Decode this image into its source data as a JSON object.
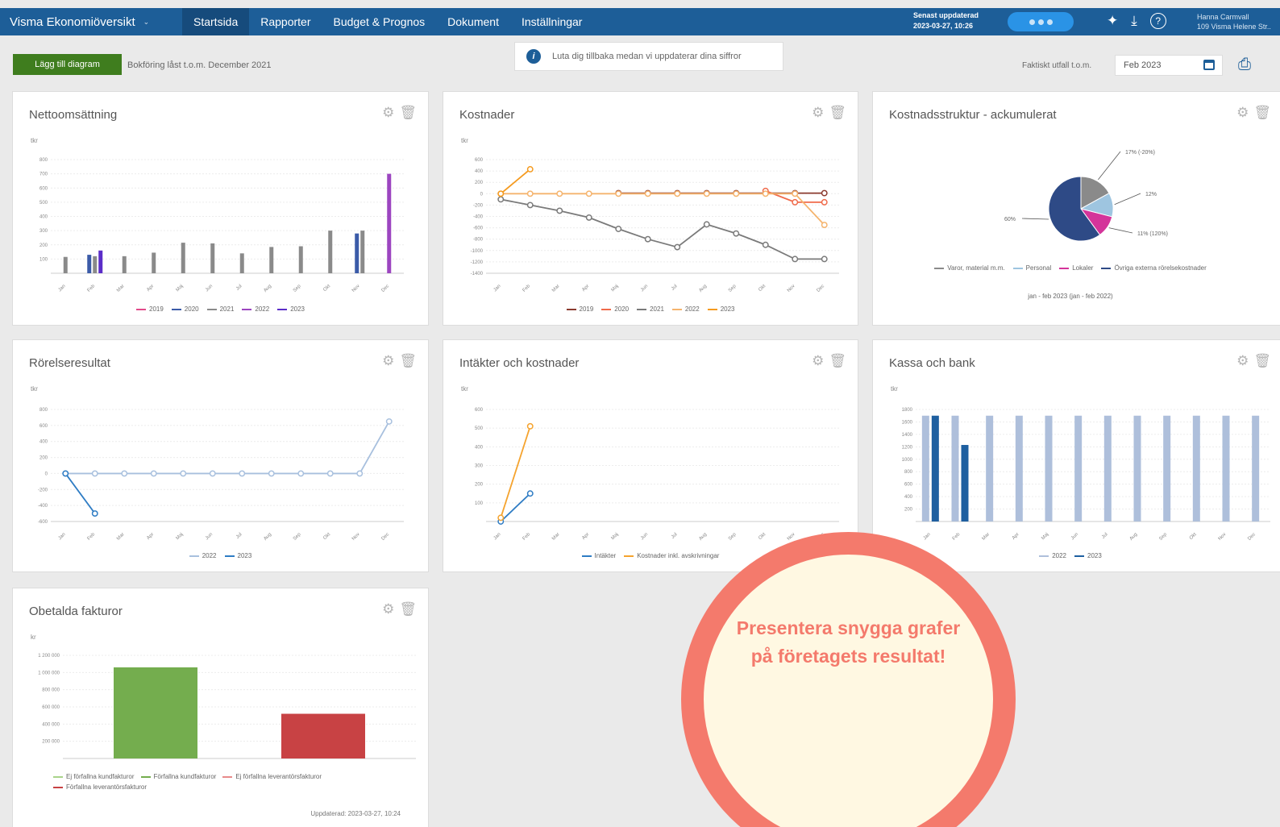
{
  "nav": {
    "app_title": "Visma Ekonomiöversikt",
    "tabs": [
      "Startsida",
      "Rapporter",
      "Budget & Prognos",
      "Dokument",
      "Inställningar"
    ],
    "updated_label": "Senast uppdaterad",
    "updated_time": "2023-03-27, 10:26",
    "user_name": "Hanna Carmvall",
    "company": "109 Visma Helene Str.."
  },
  "toolbar": {
    "add_chart_label": "Lägg till diagram",
    "bookkeeping_text": "Bokföring låst t.o.m. December 2021",
    "info_text": "Luta dig tillbaka medan vi uppdaterar dina siffror",
    "period_label": "Faktiskt utfall t.o.m.",
    "period_value": "Feb 2023"
  },
  "promo": {
    "text": "Presentera snygga grafer på företagets resultat!"
  },
  "months": [
    "Jan",
    "Feb",
    "Mar",
    "Apr",
    "Maj",
    "Jun",
    "Jul",
    "Aug",
    "Sep",
    "Okt",
    "Nov",
    "Dec"
  ],
  "chart_data": [
    {
      "type": "bar",
      "title": "Nettoomsättning",
      "unit": "tkr",
      "yticks": [
        100,
        200,
        300,
        400,
        500,
        600,
        700,
        800
      ],
      "ylim": [
        0,
        800
      ],
      "series": [
        {
          "name": "2019",
          "color": "#e24a8a",
          "values": []
        },
        {
          "name": "2020",
          "color": "#3b5ba8",
          "values": [
            null,
            130,
            null,
            null,
            null,
            null,
            null,
            null,
            null,
            null,
            280,
            null
          ]
        },
        {
          "name": "2021",
          "color": "#8a8a8a",
          "values": [
            115,
            120,
            120,
            145,
            215,
            210,
            140,
            185,
            190,
            300,
            300,
            null
          ]
        },
        {
          "name": "2022",
          "color": "#9c45c0",
          "values": [
            null,
            null,
            null,
            null,
            null,
            null,
            null,
            null,
            null,
            null,
            null,
            700
          ]
        },
        {
          "name": "2023",
          "color": "#5b2dc8",
          "values": [
            null,
            160,
            null,
            null,
            null,
            null,
            null,
            null,
            null,
            null,
            null,
            null
          ]
        }
      ]
    },
    {
      "type": "line",
      "title": "Kostnader",
      "unit": "tkr",
      "yticks": [
        600,
        400,
        200,
        0,
        -200,
        -400,
        -600,
        -800,
        -1000,
        -1200,
        -1400
      ],
      "ylim": [
        -1400,
        600
      ],
      "series": [
        {
          "name": "2019",
          "color": "#8b3a2f",
          "values": [
            null,
            null,
            null,
            null,
            10,
            10,
            10,
            10,
            10,
            10,
            10,
            10
          ]
        },
        {
          "name": "2020",
          "color": "#f06a4a",
          "values": [
            null,
            null,
            null,
            null,
            null,
            null,
            null,
            null,
            null,
            50,
            -150,
            -150
          ]
        },
        {
          "name": "2021",
          "color": "#7a7a7a",
          "values": [
            -100,
            -200,
            -300,
            -420,
            -620,
            -800,
            -940,
            -540,
            -700,
            -900,
            -1150,
            -1150
          ]
        },
        {
          "name": "2022",
          "color": "#f5b46e",
          "values": [
            0,
            0,
            0,
            0,
            0,
            0,
            0,
            0,
            0,
            0,
            0,
            -550
          ]
        },
        {
          "name": "2023",
          "color": "#f59a1e",
          "values": [
            0,
            430,
            null,
            null,
            null,
            null,
            null,
            null,
            null,
            null,
            null,
            null
          ]
        }
      ]
    },
    {
      "type": "pie",
      "title": "Kostnadsstruktur - ackumulerat",
      "subtitle": "jan - feb 2023 (jan - feb 2022)",
      "slices": [
        {
          "name": "Varor, material m.m.",
          "value": 17,
          "label": "17% (-20%)",
          "color": "#8a8a8a"
        },
        {
          "name": "Personal",
          "value": 12,
          "label": "12%",
          "color": "#9ec5e0"
        },
        {
          "name": "Lokaler",
          "value": 11,
          "label": "11% (120%)",
          "color": "#d4349a"
        },
        {
          "name": "Övriga externa rörelsekostnader",
          "value": 60,
          "label": "60%",
          "color": "#2e4a86"
        }
      ]
    },
    {
      "type": "line",
      "title": "Rörelseresultat",
      "unit": "tkr",
      "yticks": [
        800,
        600,
        400,
        200,
        0,
        -200,
        -400,
        -600
      ],
      "ylim": [
        -600,
        800
      ],
      "series": [
        {
          "name": "2022",
          "color": "#a8c0de",
          "values": [
            0,
            0,
            0,
            0,
            0,
            0,
            0,
            0,
            0,
            0,
            0,
            650
          ]
        },
        {
          "name": "2023",
          "color": "#2e7cc4",
          "values": [
            0,
            -500,
            null,
            null,
            null,
            null,
            null,
            null,
            null,
            null,
            null,
            null
          ]
        }
      ]
    },
    {
      "type": "line",
      "title": "Intäkter och kostnader",
      "unit": "tkr",
      "yticks": [
        100,
        200,
        300,
        400,
        500,
        600
      ],
      "ylim": [
        0,
        600
      ],
      "series": [
        {
          "name": "Intäkter",
          "color": "#2e7cc4",
          "values": [
            0,
            150
          ]
        },
        {
          "name": "Kostnader inkl. avskrivningar",
          "color": "#f5a32e",
          "values": [
            20,
            510
          ]
        }
      ]
    },
    {
      "type": "bar",
      "title": "Kassa och bank",
      "unit": "tkr",
      "yticks": [
        200,
        400,
        600,
        800,
        1000,
        1200,
        1400,
        1600,
        1800
      ],
      "ylim": [
        0,
        1800
      ],
      "series": [
        {
          "name": "2022",
          "color": "#aebfdb",
          "values": [
            1700,
            1700,
            1700,
            1700,
            1700,
            1700,
            1700,
            1700,
            1700,
            1700,
            1700,
            1700
          ]
        },
        {
          "name": "2023",
          "color": "#1e5fa0",
          "values": [
            1700,
            1230,
            null,
            null,
            null,
            null,
            null,
            null,
            null,
            null,
            null,
            null
          ]
        }
      ]
    },
    {
      "type": "bar",
      "title": "Obetalda fakturor",
      "unit": "kr",
      "updated": "Uppdaterad: 2023-03-27, 10:24",
      "yticks": [
        200000,
        400000,
        600000,
        800000,
        1000000,
        1200000
      ],
      "ytick_labels": [
        "200 000",
        "400 000",
        "600 000",
        "800 000",
        "1 000 000",
        "1 200 000"
      ],
      "ylim": [
        0,
        1200000
      ],
      "series": [
        {
          "name": "Ej förfallna kundfakturor",
          "color": "#a9d38a",
          "values": [
            0
          ]
        },
        {
          "name": "Förfallna kundfakturor",
          "color": "#74ad4e",
          "values": [
            1060000
          ]
        },
        {
          "name": "Ej förfallna leverantörsfakturor",
          "color": "#e88a8a",
          "values": [
            0
          ]
        },
        {
          "name": "Förfallna leverantörsfakturor",
          "color": "#c84244",
          "values": [
            520000
          ]
        }
      ]
    }
  ]
}
